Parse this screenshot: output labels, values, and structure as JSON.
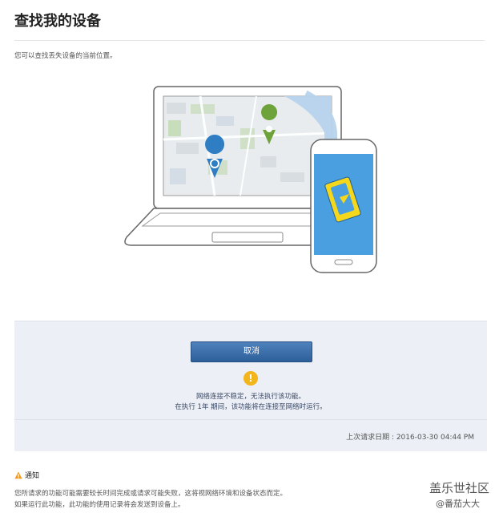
{
  "header": {
    "title": "查找我的设备",
    "subtitle": "您可以查找丢失设备的当前位置。"
  },
  "illustration": {
    "icons": [
      "laptop-icon",
      "map-pin-icon",
      "smartphone-icon"
    ],
    "colors": {
      "screen": "#4a9fe0",
      "pin_blue": "#2f7ec4",
      "pin_green": "#6ea23a",
      "phone_icon": "#f5d81c"
    }
  },
  "panel": {
    "cancel_label": "取消",
    "message_line1": "网络连接不稳定，无法执行该功能。",
    "message_line2": "在执行 1年 期间，该功能将在连接至网络时运行。",
    "last_request": "上次请求日期 : 2016-03-30 04:44 PM",
    "colors": {
      "button": "#3b6ea8",
      "warning": "#f2b51c",
      "panel_bg": "#eceff6"
    }
  },
  "notice": {
    "title": "通知",
    "line1": "您所请求的功能可能需要较长时间完成或请求可能失败，这将视网络环境和设备状态而定。",
    "line2": "如果运行此功能，此功能的使用记录将会发送到设备上。"
  },
  "watermark": {
    "brand": "盖乐世社区",
    "user": "@番茄大大"
  }
}
